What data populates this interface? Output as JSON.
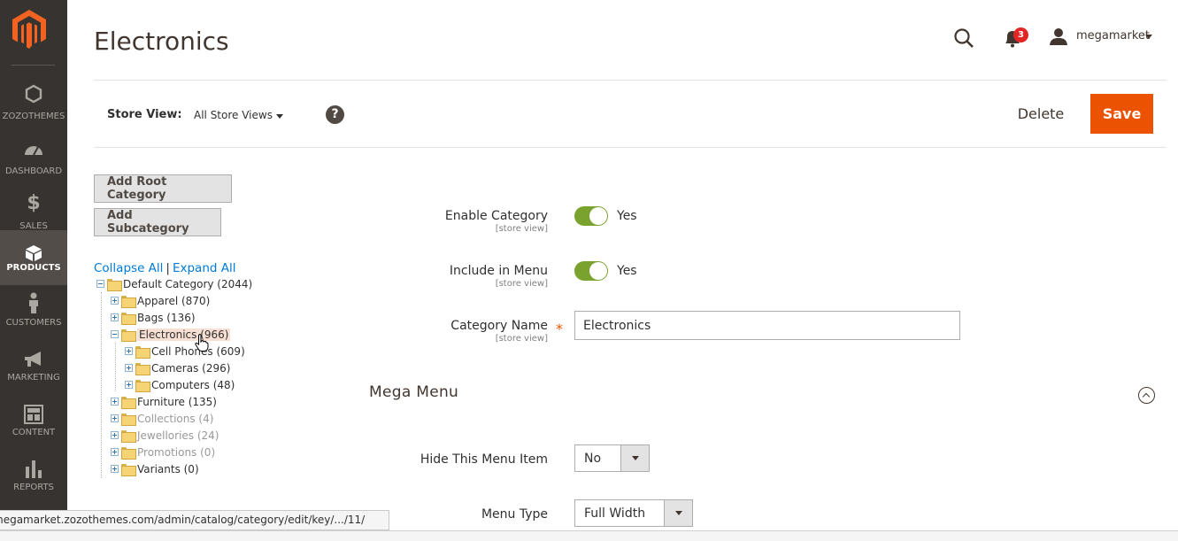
{
  "sidebar": {
    "items": [
      {
        "label": "ZOZOTHEMES",
        "icon": "hexagon-icon",
        "active": false
      },
      {
        "label": "DASHBOARD",
        "icon": "dashboard-gauge-icon",
        "active": false
      },
      {
        "label": "SALES",
        "icon": "dollar-icon",
        "active": false
      },
      {
        "label": "PRODUCTS",
        "icon": "cube-icon",
        "active": true
      },
      {
        "label": "CUSTOMERS",
        "icon": "person-icon",
        "active": false
      },
      {
        "label": "MARKETING",
        "icon": "megaphone-icon",
        "active": false
      },
      {
        "label": "CONTENT",
        "icon": "layout-icon",
        "active": false
      },
      {
        "label": "REPORTS",
        "icon": "bar-chart-icon",
        "active": false
      }
    ]
  },
  "header": {
    "title": "Electronics",
    "notification_count": "3",
    "user_name": "megamarket"
  },
  "store_bar": {
    "label": "Store View:",
    "value": "All Store Views",
    "help": "?",
    "delete_label": "Delete",
    "save_label": "Save"
  },
  "tree_actions": {
    "add_root": "Add Root Category",
    "add_sub": "Add Subcategory",
    "collapse_all": "Collapse All",
    "separator": "|",
    "expand_all": "Expand All"
  },
  "tree": [
    {
      "label": "Default Category (2044)",
      "level": 0,
      "expanded": true
    },
    {
      "label": "Apparel (870)",
      "level": 1,
      "expanded": false
    },
    {
      "label": "Bags (136)",
      "level": 1,
      "expanded": false
    },
    {
      "label": "Electronics (966)",
      "level": 1,
      "expanded": true,
      "selected": true
    },
    {
      "label": "Cell Phones (609)",
      "level": 2,
      "expanded": false
    },
    {
      "label": "Cameras (296)",
      "level": 2,
      "expanded": false
    },
    {
      "label": "Computers (48)",
      "level": 2,
      "expanded": false
    },
    {
      "label": "Furniture (135)",
      "level": 1,
      "expanded": false
    },
    {
      "label": "Collections (4)",
      "level": 1,
      "expanded": false,
      "disabled": true
    },
    {
      "label": "Jewellories (24)",
      "level": 1,
      "expanded": false,
      "disabled": true
    },
    {
      "label": "Promotions (0)",
      "level": 1,
      "expanded": false,
      "disabled": true
    },
    {
      "label": "Variants (0)",
      "level": 1,
      "expanded": false
    }
  ],
  "form": {
    "enable_category": {
      "label": "Enable Category",
      "scope": "[store view]",
      "value": "Yes"
    },
    "include_in_menu": {
      "label": "Include in Menu",
      "scope": "[store view]",
      "value": "Yes"
    },
    "category_name": {
      "label": "Category Name",
      "scope": "[store view]",
      "value": "Electronics",
      "required": "*"
    }
  },
  "mega_menu": {
    "title": "Mega Menu",
    "hide_item": {
      "label": "Hide This Menu Item",
      "value": "No"
    },
    "menu_type": {
      "label": "Menu Type",
      "value": "Full Width"
    }
  },
  "status_bar": {
    "url": "megamarket.zozothemes.com/admin/catalog/category/edit/key/.../11/"
  },
  "colors": {
    "sidebar_bg": "#373330",
    "primary": "#eb5202",
    "toggle_on": "#79a22e",
    "link": "#007bdb"
  }
}
